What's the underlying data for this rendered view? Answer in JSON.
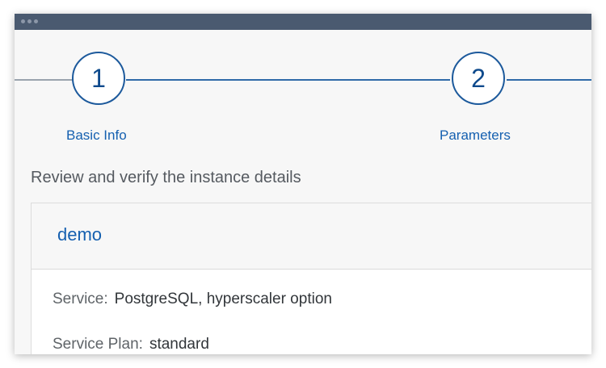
{
  "wizard": {
    "steps": [
      {
        "number": "1",
        "label": "Basic Info"
      },
      {
        "number": "2",
        "label": "Parameters"
      }
    ]
  },
  "main": {
    "instructions": "Review and verify the instance details",
    "instance": {
      "name": "demo",
      "details": [
        {
          "label": "Service:",
          "value": "PostgreSQL, hyperscaler option"
        },
        {
          "label": "Service Plan:",
          "value": "standard"
        }
      ]
    }
  },
  "colors": {
    "titlebar": "#4a5a70",
    "accent": "#1560b0",
    "step_border": "#1d5a9c"
  }
}
